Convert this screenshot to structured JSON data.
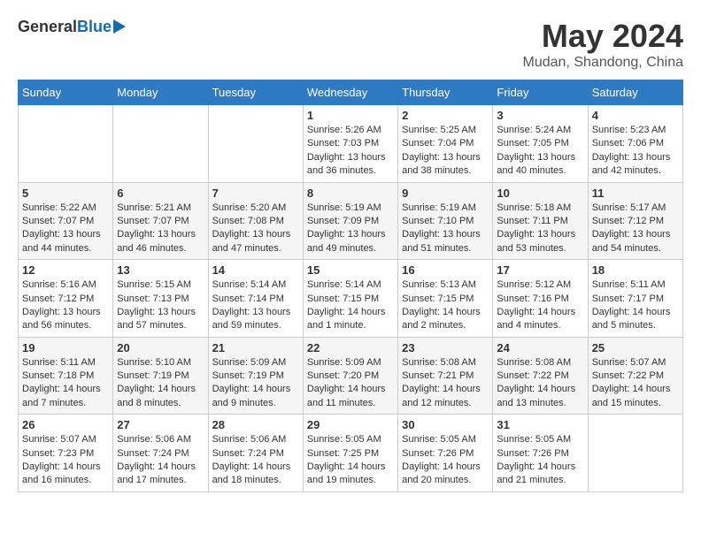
{
  "header": {
    "logo": {
      "general": "General",
      "blue": "Blue"
    },
    "title": "May 2024",
    "location": "Mudan, Shandong, China"
  },
  "calendar": {
    "weekdays": [
      "Sunday",
      "Monday",
      "Tuesday",
      "Wednesday",
      "Thursday",
      "Friday",
      "Saturday"
    ],
    "weeks": [
      [
        {
          "day": "",
          "info": ""
        },
        {
          "day": "",
          "info": ""
        },
        {
          "day": "",
          "info": ""
        },
        {
          "day": "1",
          "info": "Sunrise: 5:26 AM\nSunset: 7:03 PM\nDaylight: 13 hours\nand 36 minutes."
        },
        {
          "day": "2",
          "info": "Sunrise: 5:25 AM\nSunset: 7:04 PM\nDaylight: 13 hours\nand 38 minutes."
        },
        {
          "day": "3",
          "info": "Sunrise: 5:24 AM\nSunset: 7:05 PM\nDaylight: 13 hours\nand 40 minutes."
        },
        {
          "day": "4",
          "info": "Sunrise: 5:23 AM\nSunset: 7:06 PM\nDaylight: 13 hours\nand 42 minutes."
        }
      ],
      [
        {
          "day": "5",
          "info": "Sunrise: 5:22 AM\nSunset: 7:07 PM\nDaylight: 13 hours\nand 44 minutes."
        },
        {
          "day": "6",
          "info": "Sunrise: 5:21 AM\nSunset: 7:07 PM\nDaylight: 13 hours\nand 46 minutes."
        },
        {
          "day": "7",
          "info": "Sunrise: 5:20 AM\nSunset: 7:08 PM\nDaylight: 13 hours\nand 47 minutes."
        },
        {
          "day": "8",
          "info": "Sunrise: 5:19 AM\nSunset: 7:09 PM\nDaylight: 13 hours\nand 49 minutes."
        },
        {
          "day": "9",
          "info": "Sunrise: 5:19 AM\nSunset: 7:10 PM\nDaylight: 13 hours\nand 51 minutes."
        },
        {
          "day": "10",
          "info": "Sunrise: 5:18 AM\nSunset: 7:11 PM\nDaylight: 13 hours\nand 53 minutes."
        },
        {
          "day": "11",
          "info": "Sunrise: 5:17 AM\nSunset: 7:12 PM\nDaylight: 13 hours\nand 54 minutes."
        }
      ],
      [
        {
          "day": "12",
          "info": "Sunrise: 5:16 AM\nSunset: 7:12 PM\nDaylight: 13 hours\nand 56 minutes."
        },
        {
          "day": "13",
          "info": "Sunrise: 5:15 AM\nSunset: 7:13 PM\nDaylight: 13 hours\nand 57 minutes."
        },
        {
          "day": "14",
          "info": "Sunrise: 5:14 AM\nSunset: 7:14 PM\nDaylight: 13 hours\nand 59 minutes."
        },
        {
          "day": "15",
          "info": "Sunrise: 5:14 AM\nSunset: 7:15 PM\nDaylight: 14 hours\nand 1 minute."
        },
        {
          "day": "16",
          "info": "Sunrise: 5:13 AM\nSunset: 7:15 PM\nDaylight: 14 hours\nand 2 minutes."
        },
        {
          "day": "17",
          "info": "Sunrise: 5:12 AM\nSunset: 7:16 PM\nDaylight: 14 hours\nand 4 minutes."
        },
        {
          "day": "18",
          "info": "Sunrise: 5:11 AM\nSunset: 7:17 PM\nDaylight: 14 hours\nand 5 minutes."
        }
      ],
      [
        {
          "day": "19",
          "info": "Sunrise: 5:11 AM\nSunset: 7:18 PM\nDaylight: 14 hours\nand 7 minutes."
        },
        {
          "day": "20",
          "info": "Sunrise: 5:10 AM\nSunset: 7:19 PM\nDaylight: 14 hours\nand 8 minutes."
        },
        {
          "day": "21",
          "info": "Sunrise: 5:09 AM\nSunset: 7:19 PM\nDaylight: 14 hours\nand 9 minutes."
        },
        {
          "day": "22",
          "info": "Sunrise: 5:09 AM\nSunset: 7:20 PM\nDaylight: 14 hours\nand 11 minutes."
        },
        {
          "day": "23",
          "info": "Sunrise: 5:08 AM\nSunset: 7:21 PM\nDaylight: 14 hours\nand 12 minutes."
        },
        {
          "day": "24",
          "info": "Sunrise: 5:08 AM\nSunset: 7:22 PM\nDaylight: 14 hours\nand 13 minutes."
        },
        {
          "day": "25",
          "info": "Sunrise: 5:07 AM\nSunset: 7:22 PM\nDaylight: 14 hours\nand 15 minutes."
        }
      ],
      [
        {
          "day": "26",
          "info": "Sunrise: 5:07 AM\nSunset: 7:23 PM\nDaylight: 14 hours\nand 16 minutes."
        },
        {
          "day": "27",
          "info": "Sunrise: 5:06 AM\nSunset: 7:24 PM\nDaylight: 14 hours\nand 17 minutes."
        },
        {
          "day": "28",
          "info": "Sunrise: 5:06 AM\nSunset: 7:24 PM\nDaylight: 14 hours\nand 18 minutes."
        },
        {
          "day": "29",
          "info": "Sunrise: 5:05 AM\nSunset: 7:25 PM\nDaylight: 14 hours\nand 19 minutes."
        },
        {
          "day": "30",
          "info": "Sunrise: 5:05 AM\nSunset: 7:26 PM\nDaylight: 14 hours\nand 20 minutes."
        },
        {
          "day": "31",
          "info": "Sunrise: 5:05 AM\nSunset: 7:26 PM\nDaylight: 14 hours\nand 21 minutes."
        },
        {
          "day": "",
          "info": ""
        }
      ]
    ]
  }
}
